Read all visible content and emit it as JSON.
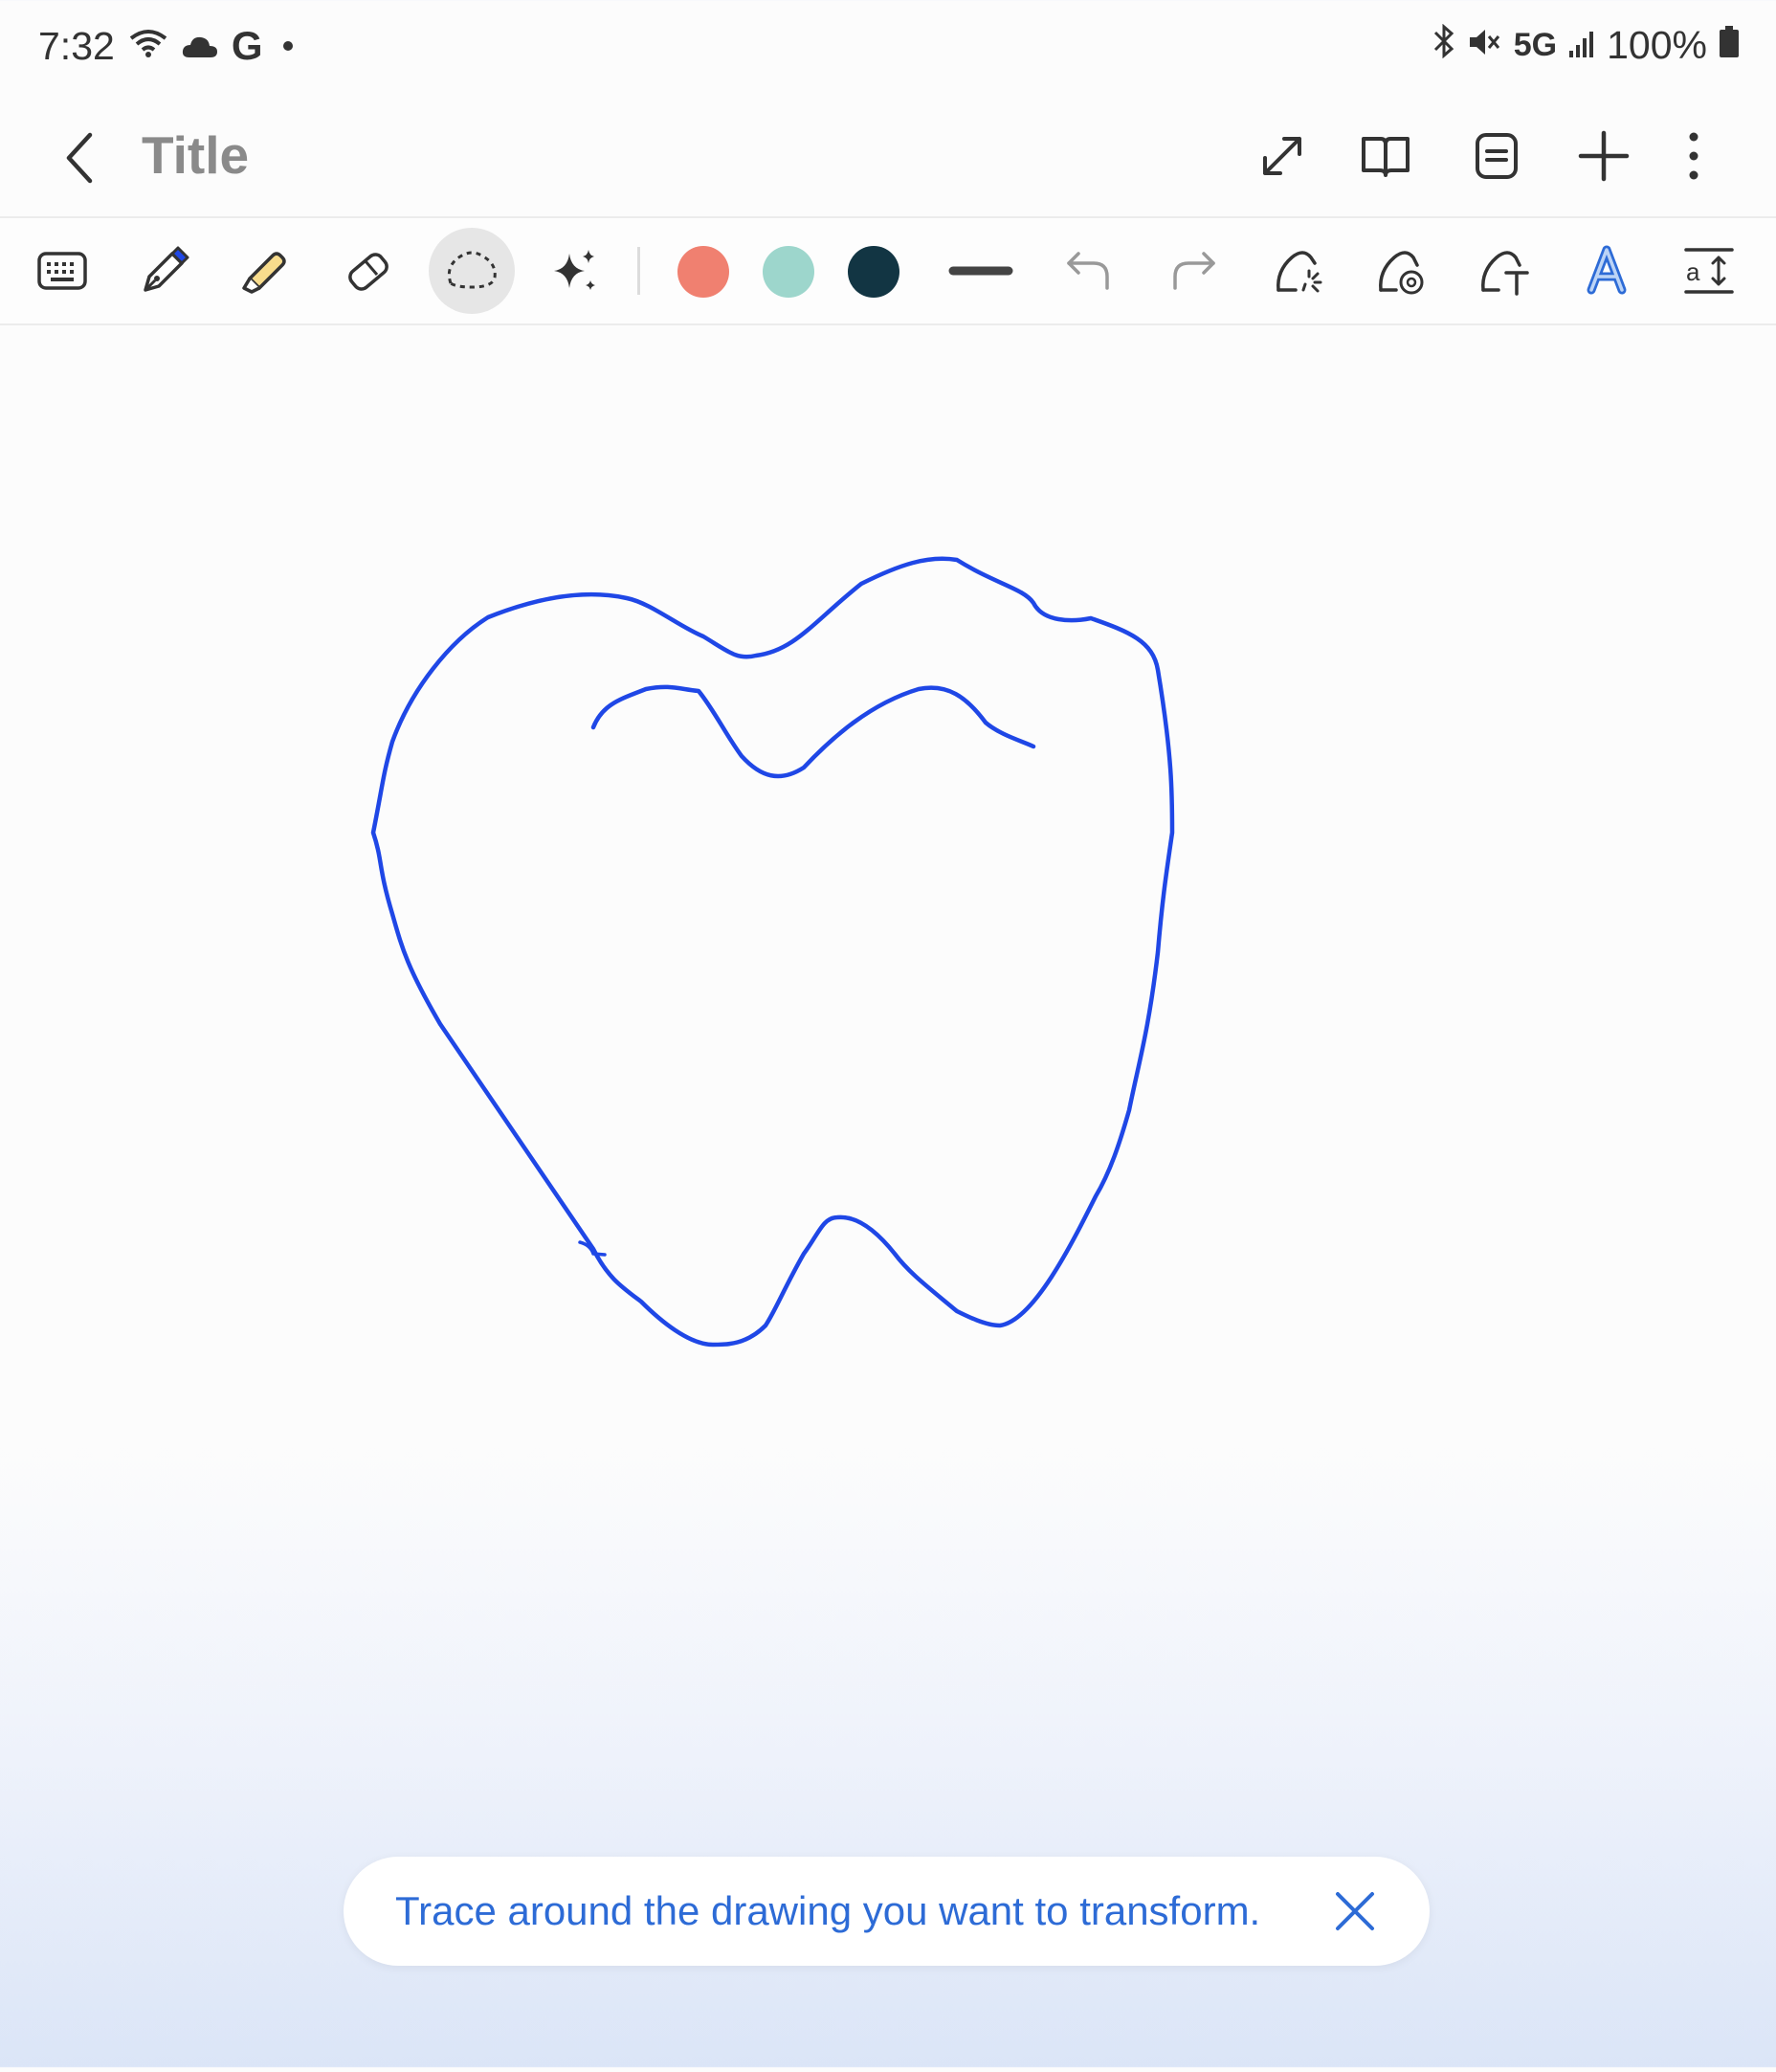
{
  "status_bar": {
    "time": "7:32",
    "left_icons": [
      "wifi-icon",
      "cloud-icon",
      "google-icon",
      "notification-dot-icon"
    ],
    "google_letter": "G",
    "network": "5G",
    "battery": "100%",
    "right_icons": [
      "bluetooth-icon",
      "mute-icon",
      "signal-icon",
      "battery-icon"
    ]
  },
  "header": {
    "title": "Title",
    "buttons": [
      "expand-icon",
      "book-view-icon",
      "page-view-icon",
      "add-icon",
      "more-icon"
    ]
  },
  "toolbar": {
    "tools": [
      "keyboard",
      "pen",
      "highlighter",
      "eraser",
      "lasso-selection",
      "ai-assist",
      "undo",
      "redo",
      "drawing-assist",
      "sketch-to-image",
      "text-transform",
      "style-text",
      "text-size"
    ],
    "active_tool": "lasso-selection",
    "colors": [
      "#f08070",
      "#9dd6cc",
      "#123543"
    ],
    "pen_color": "#1f47e6"
  },
  "toast": {
    "message": "Trace around the drawing you want to transform."
  }
}
